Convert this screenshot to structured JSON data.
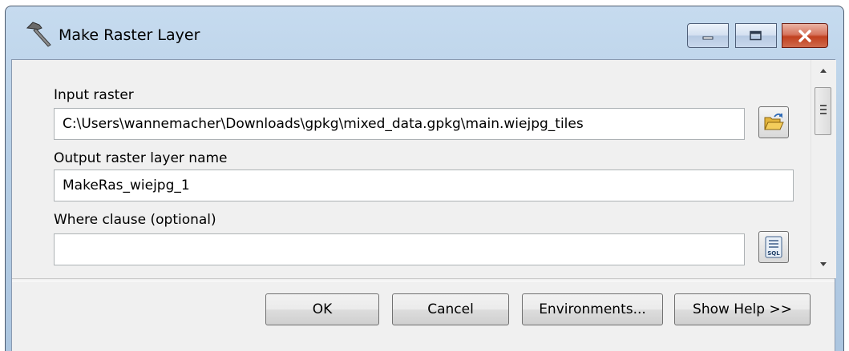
{
  "window": {
    "title": "Make Raster Layer",
    "icon": "hammer-icon"
  },
  "titlebar_buttons": {
    "minimize_icon": "minimize-icon",
    "maximize_icon": "maximize-icon",
    "close_icon": "close-icon"
  },
  "params": {
    "input_raster": {
      "label": "Input raster",
      "value": "C:\\Users\\wannemacher\\Downloads\\gpkg\\mixed_data.gpkg\\main.wiejpg_tiles",
      "browse_icon": "folder-open-icon"
    },
    "output_name": {
      "label": "Output raster layer name",
      "value": "MakeRas_wiejpg_1"
    },
    "where_clause": {
      "label": "Where clause (optional)",
      "value": "",
      "sql_icon": "sql-query-icon",
      "sql_text": "SQL"
    }
  },
  "buttons": {
    "ok": "OK",
    "cancel": "Cancel",
    "environments": "Environments...",
    "show_help": "Show Help >>"
  },
  "colors": {
    "titlebar": "#b9d1ea",
    "dialog_bg": "#f0f0f0",
    "close_button": "#c7472c"
  }
}
